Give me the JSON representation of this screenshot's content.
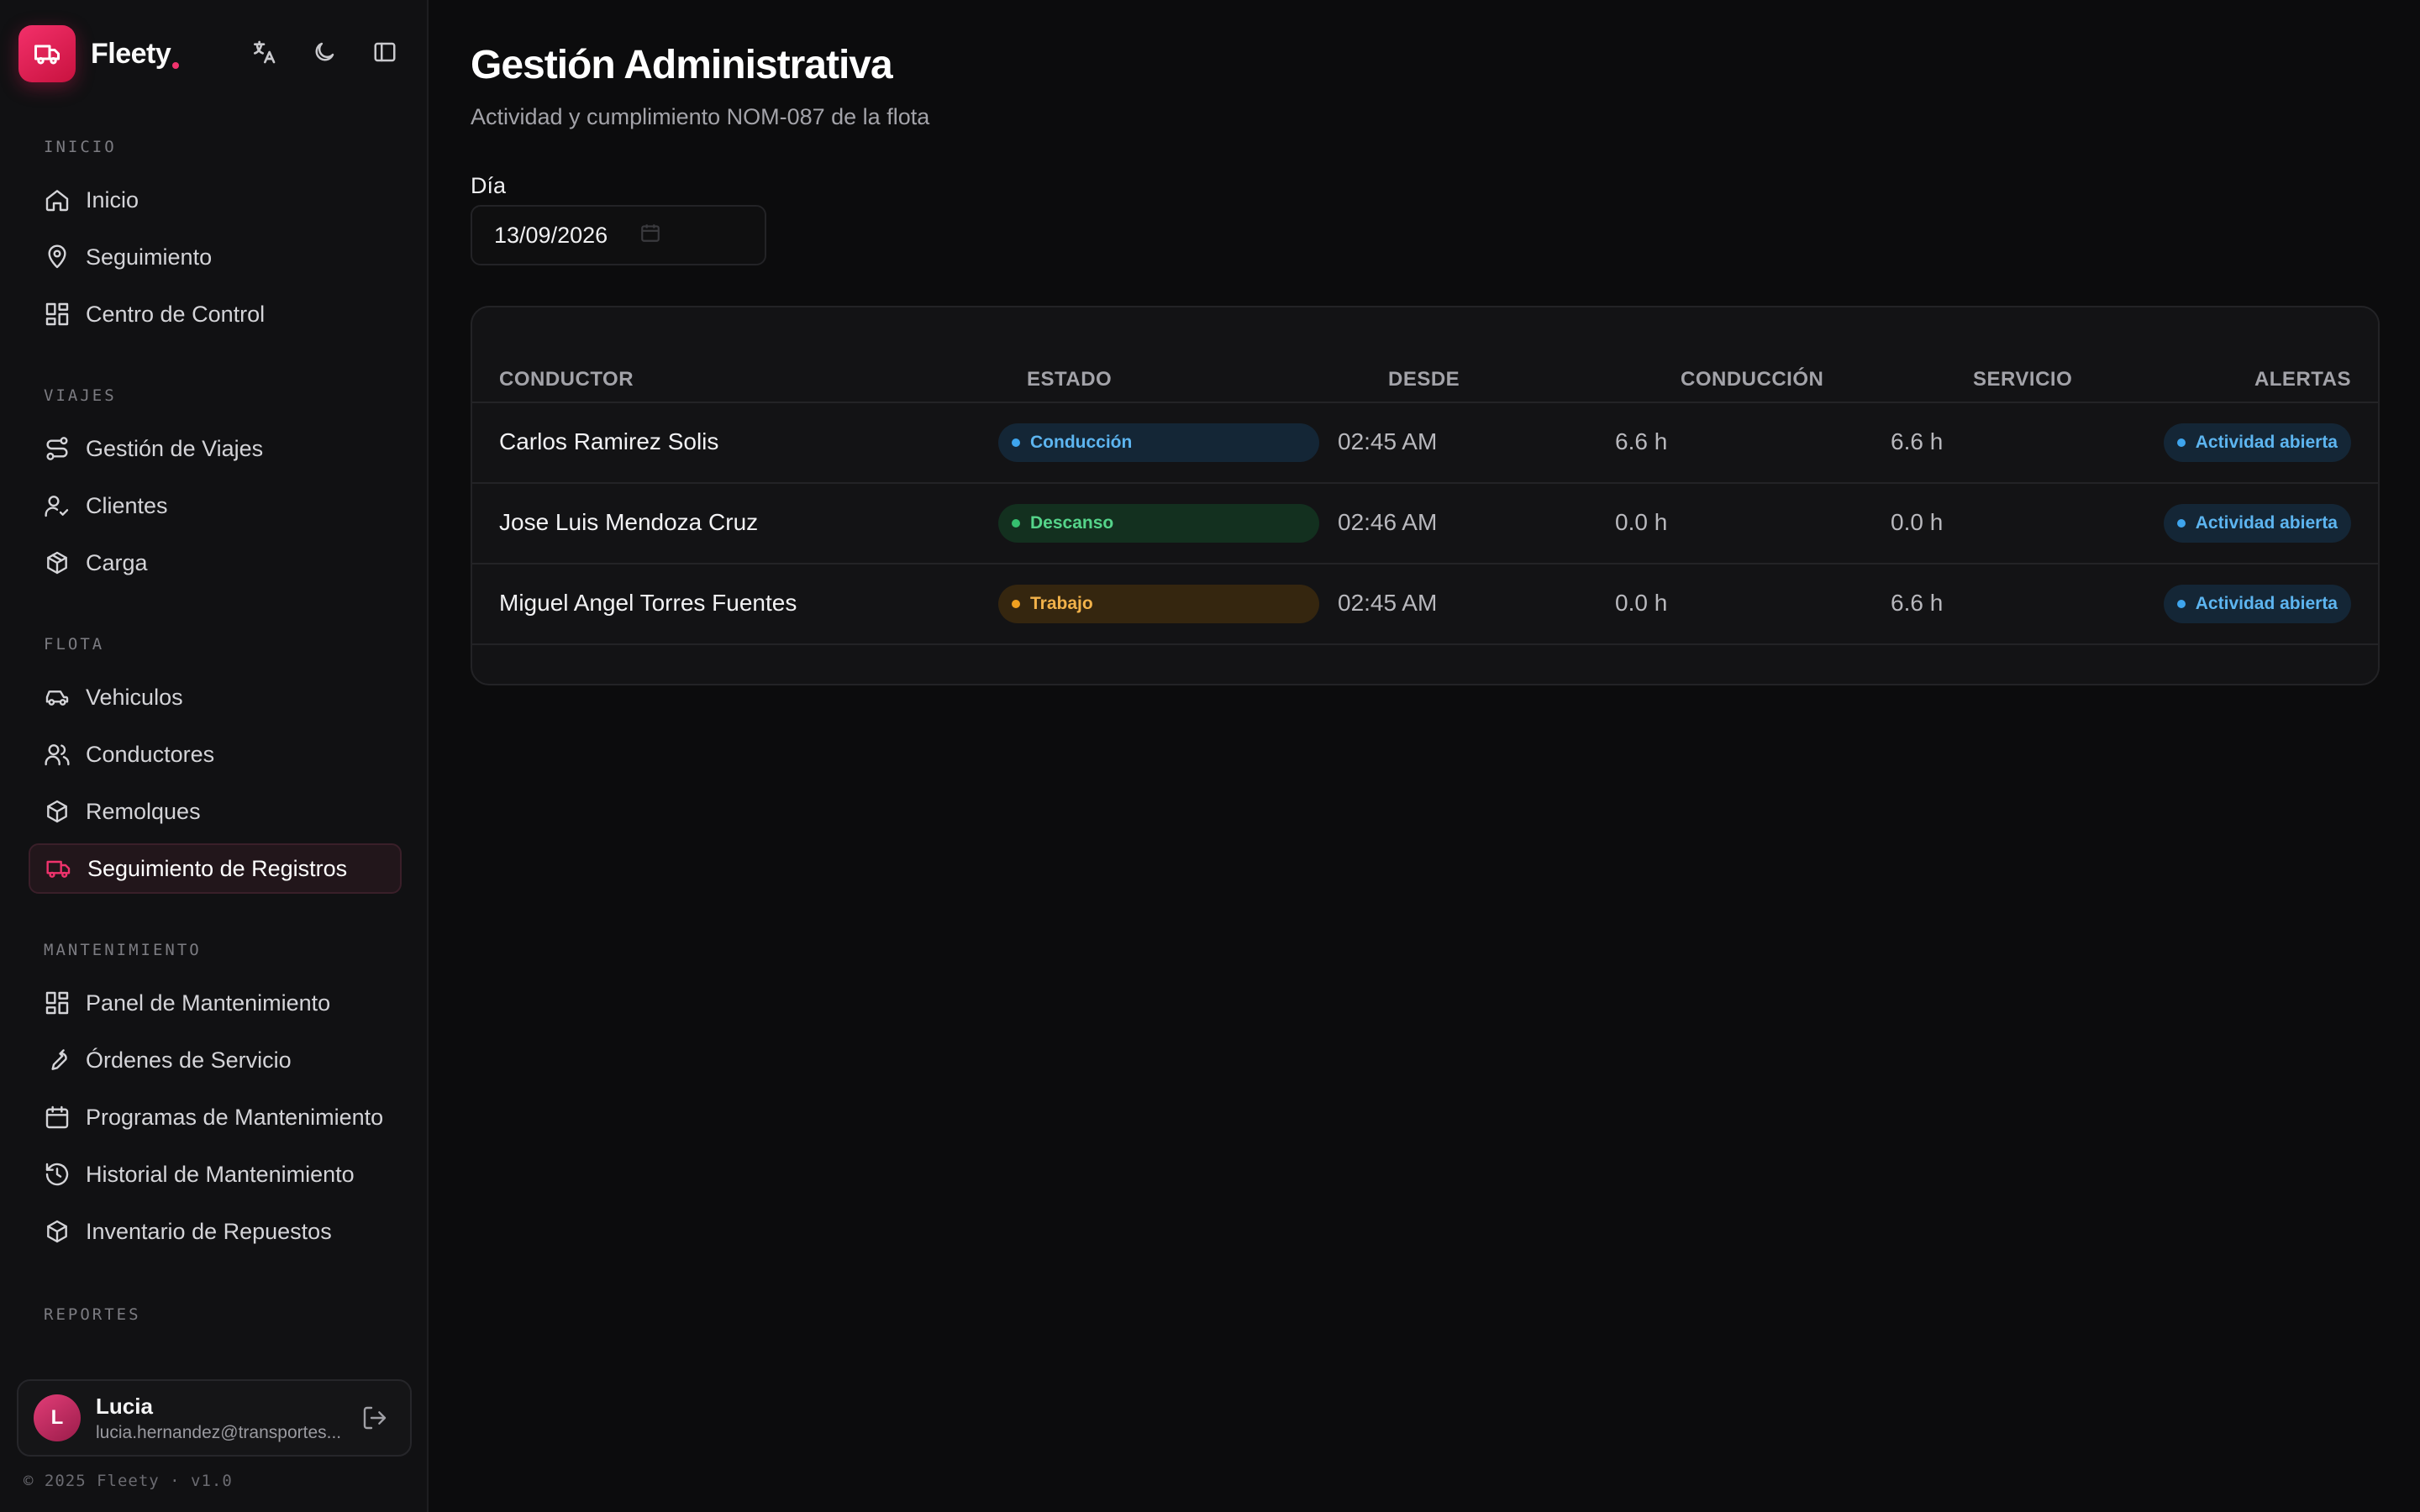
{
  "app": {
    "name": "Fleety"
  },
  "sidebar": {
    "sections": [
      {
        "label": "INICIO",
        "items": [
          {
            "label": "Inicio",
            "icon": "home-icon"
          },
          {
            "label": "Seguimiento",
            "icon": "map-pin-icon"
          },
          {
            "label": "Centro de Control",
            "icon": "dashboard-icon"
          }
        ]
      },
      {
        "label": "VIAJES",
        "items": [
          {
            "label": "Gestión de Viajes",
            "icon": "route-icon"
          },
          {
            "label": "Clientes",
            "icon": "user-check-icon"
          },
          {
            "label": "Carga",
            "icon": "package-icon"
          }
        ]
      },
      {
        "label": "FLOTA",
        "items": [
          {
            "label": "Vehiculos",
            "icon": "car-icon"
          },
          {
            "label": "Conductores",
            "icon": "users-icon"
          },
          {
            "label": "Remolques",
            "icon": "box-icon"
          },
          {
            "label": "Seguimiento de Registros",
            "icon": "truck-icon"
          }
        ]
      },
      {
        "label": "MANTENIMIENTO",
        "items": [
          {
            "label": "Panel de Mantenimiento",
            "icon": "dashboard-icon"
          },
          {
            "label": "Órdenes de Servicio",
            "icon": "wrench-icon"
          },
          {
            "label": "Programas de Mantenimiento",
            "icon": "calendar-icon"
          },
          {
            "label": "Historial de Mantenimiento",
            "icon": "history-icon"
          },
          {
            "label": "Inventario de Repuestos",
            "icon": "box-icon"
          }
        ]
      },
      {
        "label": "REPORTES",
        "items": []
      }
    ],
    "active_item": "Seguimiento de Registros",
    "user": {
      "initial": "L",
      "name": "Lucia",
      "email": "lucia.hernandez@transportes..."
    },
    "copyright": "© 2025 Fleety · v1.0"
  },
  "page": {
    "title": "Gestión Administrativa",
    "subtitle": "Actividad y cumplimiento NOM-087 de la flota",
    "date_label": "Día",
    "date_value": "13/09/2026"
  },
  "table": {
    "columns": [
      "CONDUCTOR",
      "ESTADO",
      "DESDE",
      "CONDUCCIÓN",
      "SERVICIO",
      "ALERTAS"
    ],
    "rows": [
      {
        "conductor": "Carlos Ramirez Solis",
        "estado": "Conducción",
        "estado_color": "#3ea5ee",
        "desde": "02:45 AM",
        "conduccion": "6.6 h",
        "servicio": "6.6 h",
        "alerta": "Actividad abierta"
      },
      {
        "conductor": "Jose Luis Mendoza Cruz",
        "estado": "Descanso",
        "estado_color": "#35c06f",
        "desde": "02:46 AM",
        "conduccion": "0.0 h",
        "servicio": "0.0 h",
        "alerta": "Actividad abierta"
      },
      {
        "conductor": "Miguel Angel Torres Fuentes",
        "estado": "Trabajo",
        "estado_color": "#f0a020",
        "desde": "02:45 AM",
        "conduccion": "0.0 h",
        "servicio": "6.6 h",
        "alerta": "Actividad abierta"
      }
    ]
  },
  "colors": {
    "accent": "#f0336d",
    "background": "#0c0c0d",
    "sidebar": "#111113"
  }
}
